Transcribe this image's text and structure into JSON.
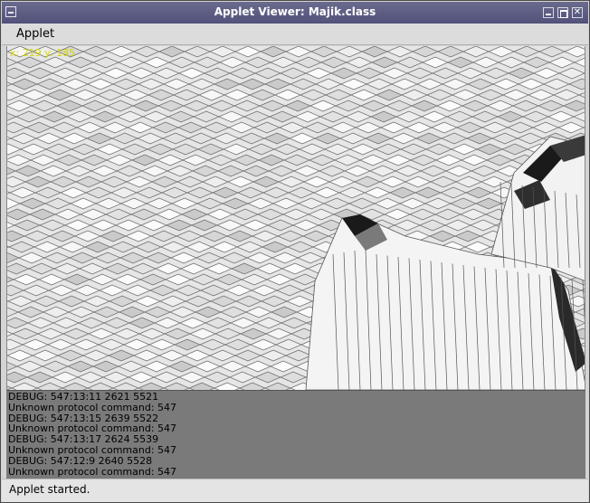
{
  "window": {
    "title": "Applet Viewer: Majik.class"
  },
  "menubar": {
    "items": [
      {
        "label": "Applet"
      }
    ]
  },
  "canvas": {
    "coords_text": "x: 219 y: 185"
  },
  "console": {
    "lines": [
      "DEBUG: 547:13:11 2621 5521",
      "Unknown protocol command: 547",
      "DEBUG: 547:13:15 2639 5522",
      "Unknown protocol command: 547",
      "DEBUG: 547:13:17 2624 5539",
      "Unknown protocol command: 547",
      "DEBUG: 547:12:9 2640 5528",
      "Unknown protocol command: 547"
    ]
  },
  "statusbar": {
    "text": "Applet started."
  },
  "colors": {
    "titlebar": "#5e5e86",
    "console_bg": "#7a7a7a",
    "coords_text": "#d8d800"
  }
}
